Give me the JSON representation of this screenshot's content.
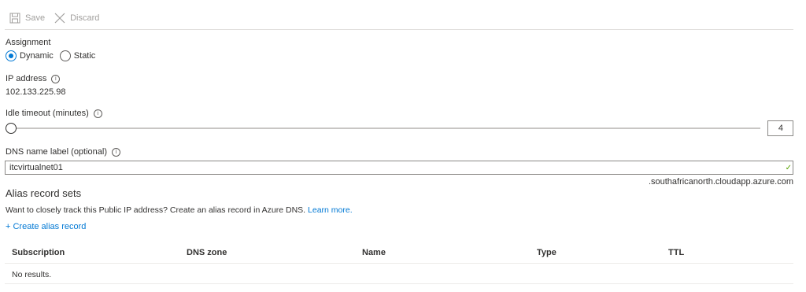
{
  "toolbar": {
    "save_label": "Save",
    "discard_label": "Discard"
  },
  "assignment": {
    "label": "Assignment",
    "options": [
      "Dynamic",
      "Static"
    ],
    "selected": "Dynamic"
  },
  "ip_address": {
    "label": "IP address",
    "value": "102.133.225.98"
  },
  "idle_timeout": {
    "label": "Idle timeout (minutes)",
    "value": "4",
    "min": 4,
    "max": 30
  },
  "dns": {
    "label": "DNS name label (optional)",
    "value": "itcvirtualnet01",
    "suffix": ".southafricanorth.cloudapp.azure.com"
  },
  "alias": {
    "title": "Alias record sets",
    "description": "Want to closely track this Public IP address? Create an alias record in Azure DNS.",
    "learn_more": "Learn more.",
    "create_label": "+ Create alias record"
  },
  "table": {
    "columns": [
      "Subscription",
      "DNS zone",
      "Name",
      "Type",
      "TTL"
    ],
    "empty_text": "No results."
  },
  "colors": {
    "accent": "#0078d4",
    "valid": "#57a300"
  },
  "icons": {
    "save": "save-icon",
    "discard": "close-icon",
    "info": "info-icon",
    "valid": "checkmark-icon"
  }
}
